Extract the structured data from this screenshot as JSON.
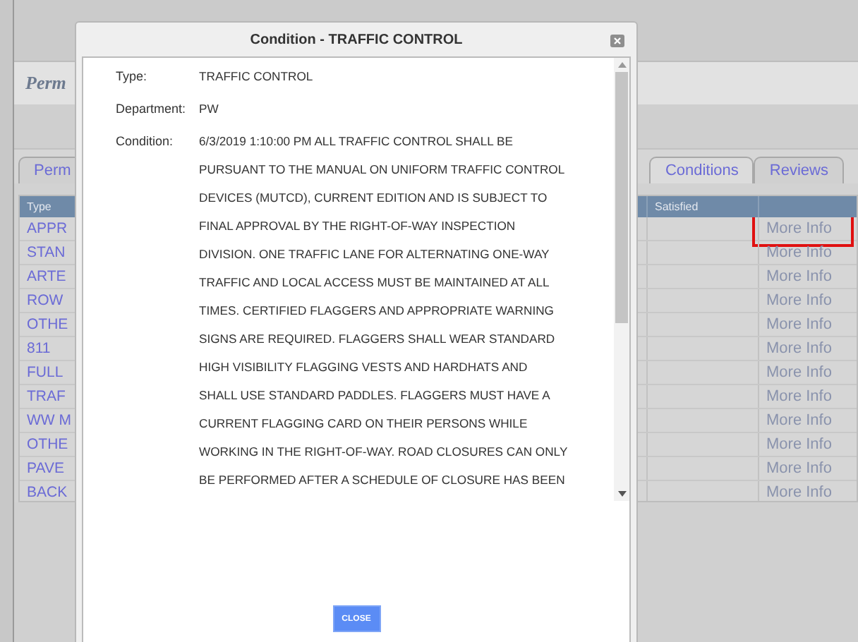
{
  "background": {
    "page_title": "Perm",
    "tabs": [
      {
        "label": "Perm",
        "selected": false
      },
      {
        "label": "Conditions",
        "selected": true
      },
      {
        "label": "Reviews",
        "selected": false
      }
    ],
    "table": {
      "columns": [
        "Type",
        "Satisfied"
      ],
      "rows": [
        {
          "type": "APPR",
          "action": "More Info",
          "highlighted": true
        },
        {
          "type": "STAN",
          "action": "More Info",
          "highlighted": false
        },
        {
          "type": "ARTE",
          "action": "More Info",
          "highlighted": false
        },
        {
          "type": "ROW",
          "action": "More Info",
          "highlighted": false
        },
        {
          "type": "OTHE",
          "action": "More Info",
          "highlighted": false
        },
        {
          "type": "811",
          "action": "More Info",
          "highlighted": false
        },
        {
          "type": "FULL",
          "action": "More Info",
          "highlighted": false
        },
        {
          "type": "TRAF",
          "action": "More Info",
          "highlighted": false
        },
        {
          "type": "WW M",
          "action": "More Info",
          "highlighted": false
        },
        {
          "type": "OTHE",
          "action": "More Info",
          "highlighted": false
        },
        {
          "type": "PAVE",
          "action": "More Info",
          "highlighted": false
        },
        {
          "type": "BACK",
          "action": "More Info",
          "highlighted": false
        }
      ]
    }
  },
  "dialog": {
    "title": "Condition - TRAFFIC CONTROL",
    "fields": [
      {
        "label": "Type:",
        "value": "TRAFFIC CONTROL"
      },
      {
        "label": "Department:",
        "value": "PW"
      },
      {
        "label": "Condition:",
        "value": "6/3/2019 1:10:00 PM ALL TRAFFIC CONTROL SHALL BE\nPURSUANT TO THE MANUAL ON UNIFORM TRAFFIC CONTROL\nDEVICES (MUTCD), CURRENT EDITION AND IS SUBJECT TO\nFINAL APPROVAL BY THE RIGHT-OF-WAY INSPECTION\nDIVISION. ONE TRAFFIC LANE FOR ALTERNATING ONE-WAY\nTRAFFIC AND LOCAL ACCESS MUST BE MAINTAINED AT ALL\nTIMES. CERTIFIED FLAGGERS AND APPROPRIATE WARNING\nSIGNS ARE REQUIRED. FLAGGERS SHALL WEAR STANDARD\nHIGH VISIBILITY FLAGGING VESTS AND HARDHATS AND\nSHALL USE STANDARD PADDLES. FLAGGERS MUST HAVE A\nCURRENT FLAGGING CARD ON THEIR PERSONS WHILE\nWORKING IN THE RIGHT-OF-WAY. ROAD CLOSURES CAN ONLY\nBE PERFORMED AFTER A SCHEDULE OF CLOSURE HAS BEEN"
      }
    ],
    "button": "CLOSE"
  }
}
